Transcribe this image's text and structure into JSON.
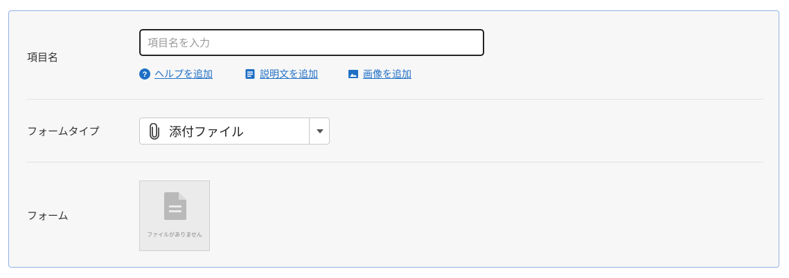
{
  "item_name_row": {
    "label": "項目名",
    "input_placeholder": "項目名を入力",
    "input_value": "",
    "links": [
      {
        "label": "ヘルプを追加",
        "icon": "help-circle-icon"
      },
      {
        "label": "説明文を追加",
        "icon": "description-icon"
      },
      {
        "label": "画像を追加",
        "icon": "image-icon"
      }
    ]
  },
  "form_type_row": {
    "label": "フォームタイプ",
    "selected_value": "添付ファイル",
    "selected_icon": "paperclip-icon"
  },
  "form_row": {
    "label": "フォーム",
    "file_placeholder_text": "ファイルがありません",
    "file_icon": "document-icon"
  },
  "colors": {
    "panel_background": "#f7f7f7",
    "panel_border": "#8fb2e6",
    "link": "#1f6fc5"
  }
}
